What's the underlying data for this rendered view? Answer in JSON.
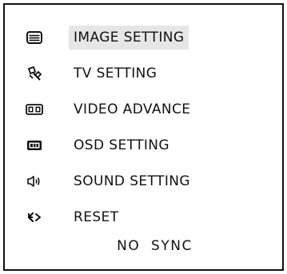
{
  "menu": {
    "items": [
      {
        "label": "IMAGE SETTING",
        "icon": "image-setting-icon",
        "selected": true
      },
      {
        "label": "TV SETTING",
        "icon": "tv-setting-icon",
        "selected": false
      },
      {
        "label": "VIDEO ADVANCE",
        "icon": "video-advance-icon",
        "selected": false
      },
      {
        "label": "OSD SETTING",
        "icon": "osd-setting-icon",
        "selected": false
      },
      {
        "label": "SOUND SETTING",
        "icon": "speaker-icon",
        "selected": false
      },
      {
        "label": "RESET",
        "icon": "reset-icon",
        "selected": false
      }
    ]
  },
  "status": {
    "text": "NO  SYNC"
  },
  "colors": {
    "foreground": "#111111",
    "highlight": "#e6e6e6",
    "background": "#ffffff"
  }
}
